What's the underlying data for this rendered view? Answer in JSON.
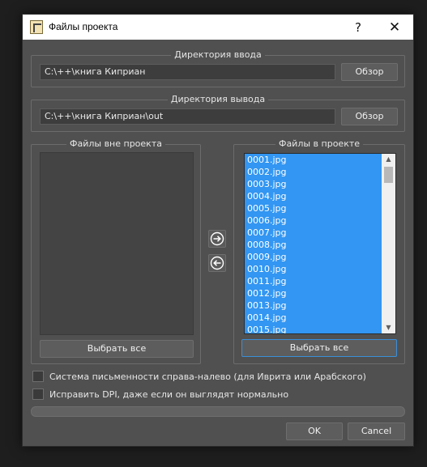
{
  "window": {
    "title": "Файлы проекта",
    "help_label": "?",
    "close_label": "✕"
  },
  "input_dir": {
    "title": "Директория ввода",
    "path": "C:\\++\\книга Киприан",
    "browse_label": "Обзор"
  },
  "output_dir": {
    "title": "Директория вывода",
    "path": "C:\\++\\книга Киприан\\out",
    "browse_label": "Обзор"
  },
  "outside_files": {
    "title": "Файлы вне проекта",
    "items": [],
    "select_all_label": "Выбрать все"
  },
  "project_files": {
    "title": "Файлы в проекте",
    "items": [
      "0001.jpg",
      "0002.jpg",
      "0003.jpg",
      "0004.jpg",
      "0005.jpg",
      "0006.jpg",
      "0007.jpg",
      "0008.jpg",
      "0009.jpg",
      "0010.jpg",
      "0011.jpg",
      "0012.jpg",
      "0013.jpg",
      "0014.jpg",
      "0015.jpg"
    ],
    "select_all_label": "Выбрать все"
  },
  "icons": {
    "move_right": "arrow-right-circle-icon",
    "move_left": "arrow-left-circle-icon"
  },
  "options": {
    "rtl_label": "Система письменности справа-налево (для Иврита или Арабского)",
    "fix_dpi_label": "Исправить DPI, даже если он выглядят нормально"
  },
  "footer": {
    "ok_label": "OK",
    "cancel_label": "Cancel"
  },
  "colors": {
    "accent": "#3296f2",
    "background": "#505050"
  }
}
